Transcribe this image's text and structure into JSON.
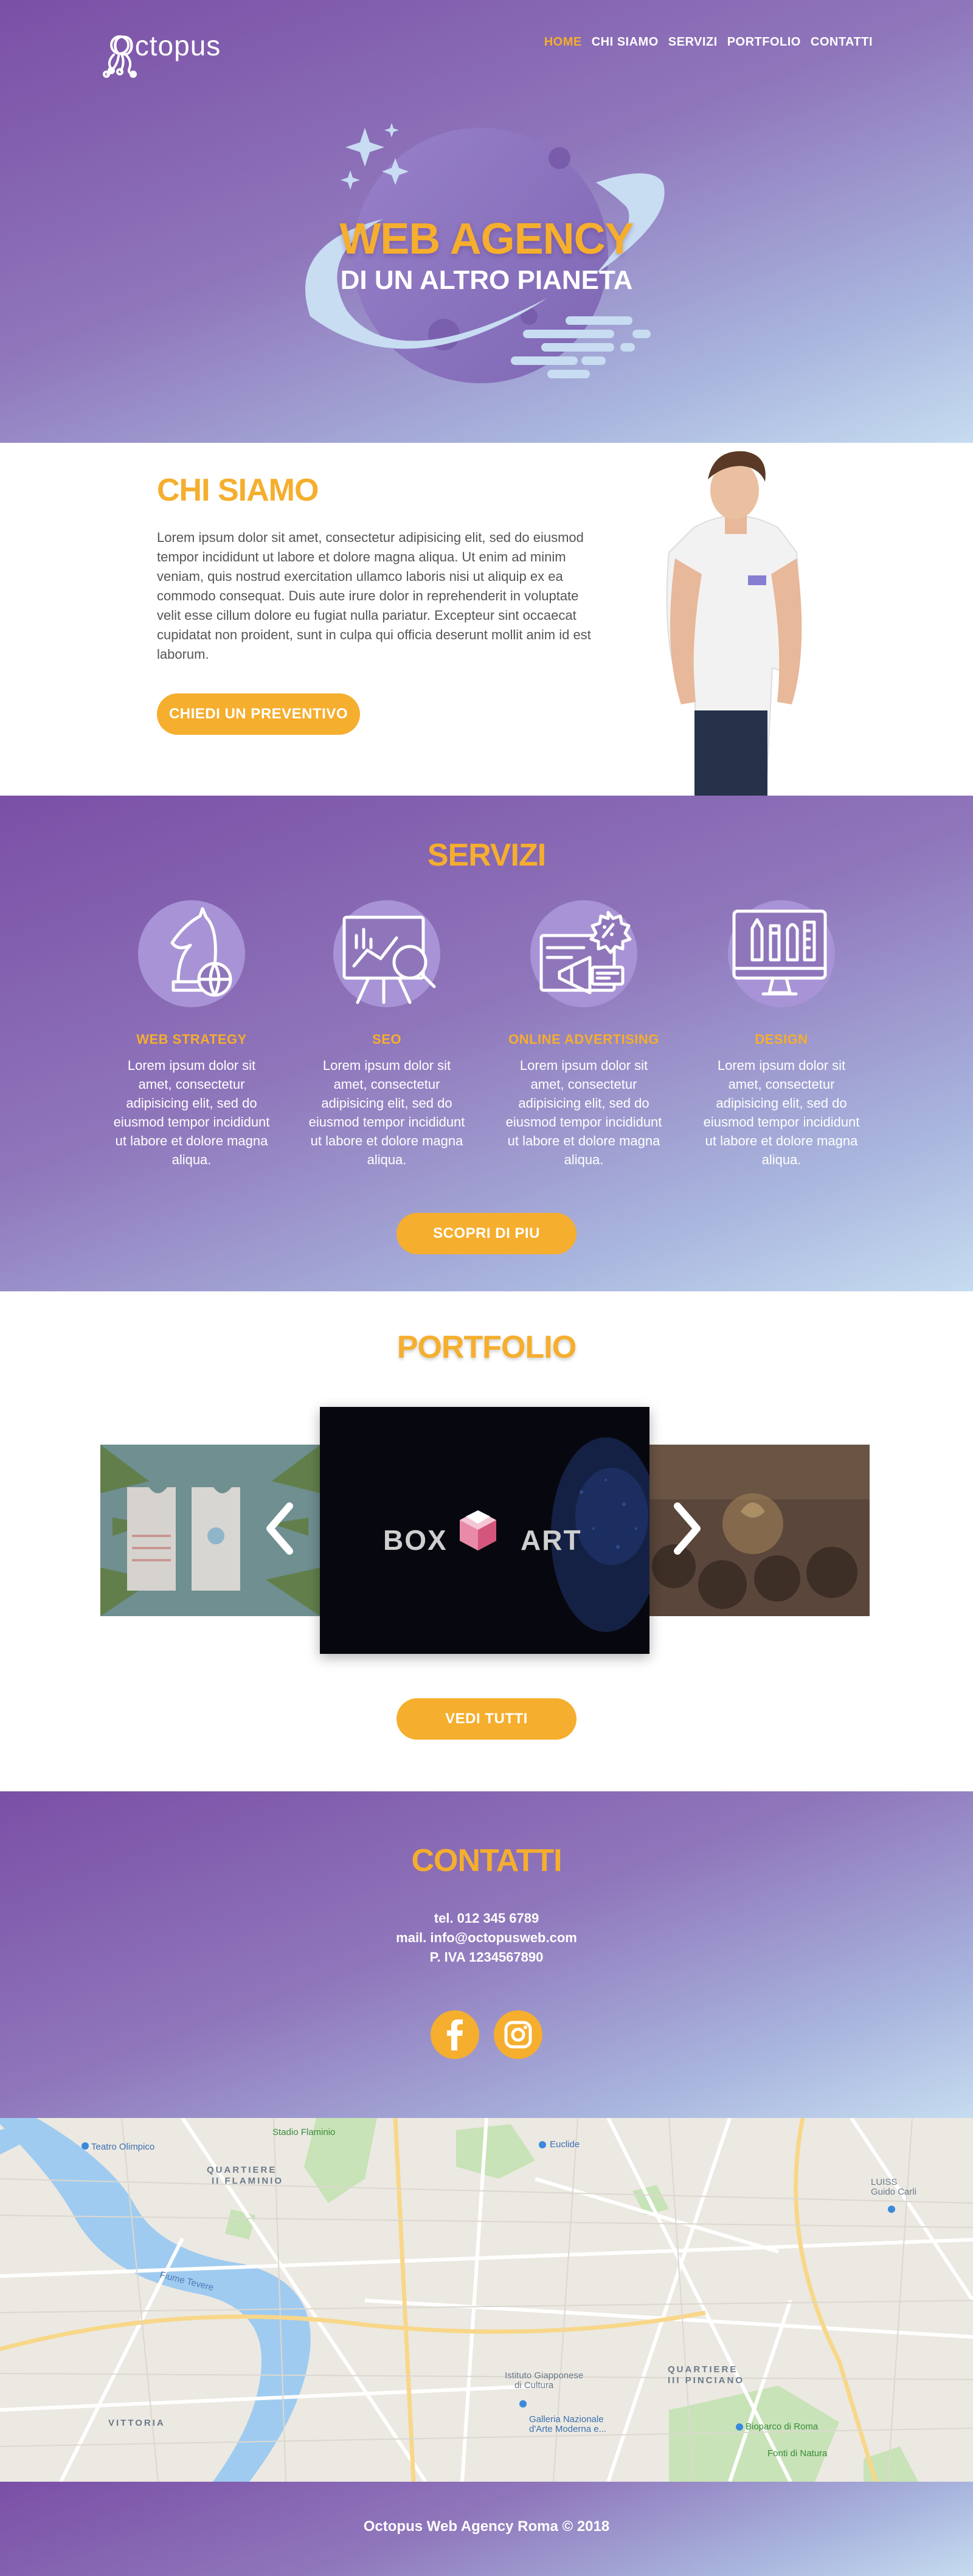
{
  "brand": {
    "name": "Octopus"
  },
  "nav": {
    "items": [
      "HOME",
      "CHI SIAMO",
      "SERVIZI",
      "PORTFOLIO",
      "CONTATTI"
    ],
    "active": "HOME"
  },
  "hero": {
    "line1": "WEB AGENCY",
    "line2": "DI UN ALTRO PIANETA"
  },
  "chi_siamo": {
    "title": "CHI SIAMO",
    "text": "Lorem ipsum dolor sit amet, consectetur adipisicing elit, sed do eiusmod tempor incididunt ut labore et dolore magna aliqua. Ut enim ad minim veniam, quis nostrud exercitation ullamco laboris nisi ut aliquip ex ea commodo consequat. Duis aute irure dolor in reprehenderit in voluptate velit esse cillum dolore eu fugiat nulla pariatur. Excepteur sint occaecat cupidatat non proident, sunt in culpa qui officia deserunt mollit anim id est laborum.",
    "button": "CHIEDI UN PREVENTIVO"
  },
  "servizi": {
    "title": "SERVIZI",
    "items": [
      {
        "label": "WEB STRATEGY",
        "icon": "chess-knight-globe-icon",
        "desc": "Lorem ipsum dolor sit amet, consectetur adipisicing elit, sed do eiusmod tempor incididunt ut labore et dolore magna aliqua."
      },
      {
        "label": "SEO",
        "icon": "chart-magnifier-icon",
        "desc": "Lorem ipsum dolor sit amet, consectetur adipisicing elit, sed do eiusmod tempor incididunt ut labore et dolore magna aliqua."
      },
      {
        "label": "ONLINE ADVERTISING",
        "icon": "megaphone-percent-icon",
        "desc": "Lorem ipsum dolor sit amet, consectetur adipisicing elit, sed do eiusmod tempor incididunt ut labore et dolore magna aliqua."
      },
      {
        "label": "DESIGN",
        "icon": "monitor-pencils-icon",
        "desc": "Lorem ipsum dolor sit amet, consectetur adipisicing elit, sed do eiusmod tempor incididunt ut labore et dolore magna aliqua."
      }
    ],
    "button": "SCOPRI DI PIU"
  },
  "portfolio": {
    "title": "PORTFOLIO",
    "center_slide": {
      "word1": "BOX",
      "word2": "ART"
    },
    "button": "VEDI TUTTI"
  },
  "contatti": {
    "title": "CONTATTI",
    "tel": "tel. 012 345 6789",
    "mail": "mail. info@octopusweb.com",
    "piva": "P. IVA 1234567890",
    "social": [
      "facebook-icon",
      "instagram-icon"
    ]
  },
  "map": {
    "labels": {
      "teatro": "Teatro Olimpico",
      "stadio": "Stadio Flaminio",
      "euclide": "Euclide",
      "flaminio": "QUARTIERE\nII FLAMINIO",
      "fiume": "Fiume Tevere",
      "luiss": "LUISS\nGuido Carli",
      "istituto": "Istituto Giapponese\ndi Cultura",
      "galleria": "Galleria Nazionale\nd'Arte Moderna e...",
      "pinciano": "QUARTIERE\nIII PINCIANO",
      "vittoria": "VITTORIA",
      "bioparco": "Bioparco di Roma",
      "natura": "Fonti di Natura"
    }
  },
  "footer": {
    "text": "Octopus Web Agency Roma © 2018"
  },
  "colors": {
    "accent": "#f5ae2e",
    "purple": "#7a4fa6",
    "light_blue": "#c6dcf0"
  }
}
